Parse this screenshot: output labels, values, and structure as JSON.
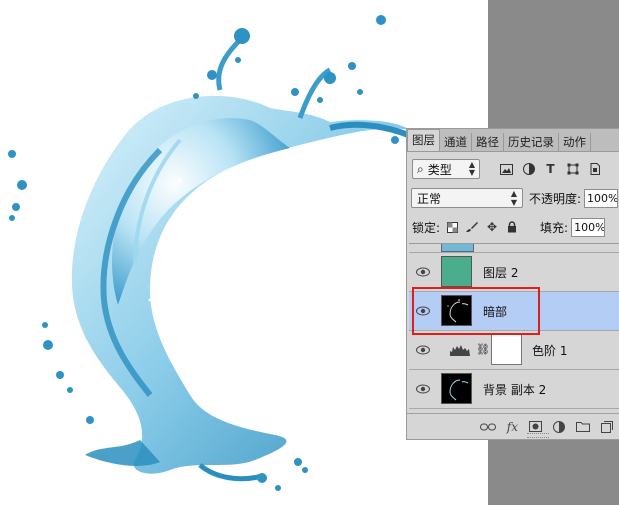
{
  "layers_panel": {
    "tabs": [
      {
        "label": "图层",
        "active": true
      },
      {
        "label": "通道",
        "active": false
      },
      {
        "label": "路径",
        "active": false
      },
      {
        "label": "历史记录",
        "active": false
      },
      {
        "label": "动作",
        "active": false
      }
    ],
    "filter": {
      "kind_label": "类型",
      "search_glyph": "⌕",
      "icons": [
        "image-filter-icon",
        "adjustment-filter-icon",
        "type-filter-icon",
        "shape-filter-icon",
        "smart-object-filter-icon"
      ]
    },
    "blend": {
      "mode": "正常",
      "opacity_label": "不透明度:",
      "opacity_value": "100%"
    },
    "lock": {
      "label": "锁定:",
      "fill_label": "填充:",
      "fill_value": "100%"
    },
    "layers": [
      {
        "name": "图层 2",
        "thumb": "teal",
        "selected": false
      },
      {
        "name": "暗部",
        "thumb": "black",
        "selected": true
      },
      {
        "name": "色阶 1",
        "thumb": "adjustment",
        "selected": false
      },
      {
        "name": "背景 副本 2",
        "thumb": "black",
        "selected": false
      }
    ]
  },
  "colors": {
    "selection": "#b4cdf5",
    "highlight_box": "#e01d1d",
    "teal_layer": "#4aad8b",
    "pasteboard": "#8a8a8a"
  }
}
